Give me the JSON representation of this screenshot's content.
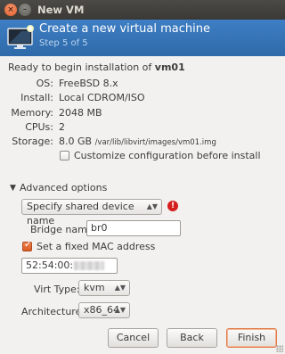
{
  "window": {
    "title": "New VM",
    "close_glyph": "×",
    "minimize_glyph": "–"
  },
  "header": {
    "title": "Create a new virtual machine",
    "step": "Step 5 of 5",
    "icon": "monitor-icon"
  },
  "summary": {
    "ready_prefix": "Ready to begin installation of ",
    "vm_name": "vm01",
    "rows": [
      {
        "label": "OS:",
        "value": "FreeBSD 8.x"
      },
      {
        "label": "Install:",
        "value": "Local CDROM/ISO"
      },
      {
        "label": "Memory:",
        "value": "2048 MB"
      },
      {
        "label": "CPUs:",
        "value": "2"
      },
      {
        "label": "Storage:",
        "value": "8.0 GB",
        "detail": "/var/lib/libvirt/images/vm01.img"
      }
    ],
    "customize_label": "Customize configuration before install",
    "customize_checked": false
  },
  "advanced": {
    "expander_glyph": "▼",
    "label": "Advanced options",
    "device_combo": "Specify shared device name",
    "combo_arrow": "▲▼",
    "warn_glyph": "!",
    "bridge_label": "Bridge name:",
    "bridge_value": "br0",
    "mac_label": "Set a fixed MAC address",
    "mac_checked": true,
    "mac_value": "52:54:00:",
    "virt_label": "Virt Type:",
    "virt_value": "kvm",
    "arch_label": "Architecture:",
    "arch_value": "x86_64"
  },
  "buttons": {
    "cancel": "Cancel",
    "back": "Back",
    "finish": "Finish"
  }
}
